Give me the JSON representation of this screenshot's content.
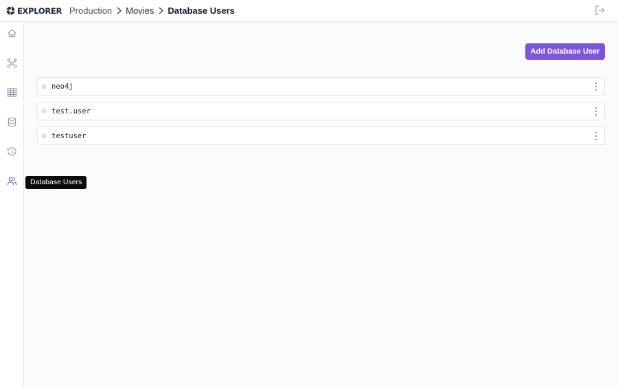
{
  "app": {
    "name": "EXPLORER"
  },
  "breadcrumb": {
    "items": [
      "Production",
      "Movies"
    ],
    "current": "Database Users"
  },
  "sidebar": {
    "items": [
      {
        "icon": "home-icon",
        "label": "Home"
      },
      {
        "icon": "graph-icon",
        "label": "Graph"
      },
      {
        "icon": "table-icon",
        "label": "Table"
      },
      {
        "icon": "database-icon",
        "label": "Database"
      },
      {
        "icon": "history-icon",
        "label": "History"
      },
      {
        "icon": "users-icon",
        "label": "Database Users"
      }
    ],
    "active_index": 5
  },
  "tooltip": {
    "text": "Database Users"
  },
  "main": {
    "add_button_label": "Add Database User",
    "users": [
      "neo4j",
      "test.user",
      "testuser"
    ]
  },
  "colors": {
    "accent": "#7c55d9",
    "active_icon": "#5b4fb8",
    "icon": "#8d93a0"
  }
}
